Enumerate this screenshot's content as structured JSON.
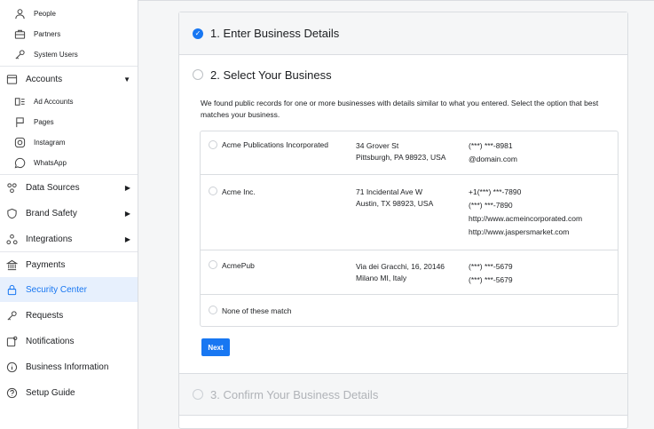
{
  "sidebar": {
    "items": [
      {
        "label": "People",
        "icon": "person-icon",
        "type": "sub"
      },
      {
        "label": "Partners",
        "icon": "briefcase-icon",
        "type": "sub"
      },
      {
        "label": "System Users",
        "icon": "key-icon",
        "type": "sub"
      },
      {
        "label": "Accounts",
        "icon": "accounts-icon",
        "type": "main",
        "caret": "▼"
      },
      {
        "label": "Ad Accounts",
        "icon": "ad-accounts-icon",
        "type": "sub"
      },
      {
        "label": "Pages",
        "icon": "flag-icon",
        "type": "sub"
      },
      {
        "label": "Instagram",
        "icon": "instagram-icon",
        "type": "sub"
      },
      {
        "label": "WhatsApp",
        "icon": "whatsapp-icon",
        "type": "sub"
      },
      {
        "label": "Data Sources",
        "icon": "data-sources-icon",
        "type": "main",
        "caret": "▶"
      },
      {
        "label": "Brand Safety",
        "icon": "shield-icon",
        "type": "main",
        "caret": "▶"
      },
      {
        "label": "Integrations",
        "icon": "integrations-icon",
        "type": "main",
        "caret": "▶"
      },
      {
        "label": "Payments",
        "icon": "bank-icon",
        "type": "main"
      },
      {
        "label": "Security Center",
        "icon": "lock-icon",
        "type": "main",
        "active": true
      },
      {
        "label": "Requests",
        "icon": "requests-icon",
        "type": "main"
      },
      {
        "label": "Notifications",
        "icon": "notifications-icon",
        "type": "main"
      },
      {
        "label": "Business Information",
        "icon": "info-icon",
        "type": "main"
      },
      {
        "label": "Setup Guide",
        "icon": "help-icon",
        "type": "main"
      }
    ]
  },
  "steps": {
    "step1": "1. Enter Business Details",
    "step2": "2. Select Your Business",
    "step3": "3. Confirm Your Business Details"
  },
  "description": "We found public records for one or more businesses with details similar to what you entered. Select the option that best matches your business.",
  "options": [
    {
      "name": "Acme Publications Incorporated",
      "address": [
        "34 Grover St",
        "Pittsburgh, PA 98923, USA"
      ],
      "contact": [
        "(***) ***-8981",
        "@domain.com"
      ]
    },
    {
      "name": "Acme Inc.",
      "address": [
        "71 Incidental Ave W",
        "Austin, TX 98923, USA"
      ],
      "contact": [
        "+1(***) ***-7890",
        "(***) ***-7890",
        "http://www.acmeincorporated.com",
        "http://www.jaspersmarket.com"
      ]
    },
    {
      "name": "AcmePub",
      "address": [
        "Via dei Gracchi, 16, 20146",
        "Milano MI, Italy"
      ],
      "contact": [
        "(***) ***-5679",
        "(***) ***-5679"
      ]
    },
    {
      "name": "None of these match",
      "address": [],
      "contact": []
    }
  ],
  "next_label": "Next",
  "colors": {
    "accent": "#1877f2",
    "active_bg": "#e7f0fd"
  }
}
